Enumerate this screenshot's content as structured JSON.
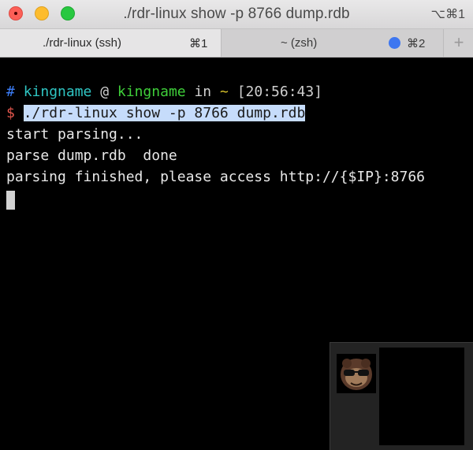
{
  "window": {
    "title": "./rdr-linux show -p 8766 dump.rdb",
    "shortcut": "⌥⌘1"
  },
  "tabs": [
    {
      "label": "./rdr-linux (ssh)",
      "shortcut": "⌘1",
      "active": true
    },
    {
      "label": "~ (zsh)",
      "shortcut": "⌘2",
      "active": false,
      "activity_color": "#3e77f0"
    }
  ],
  "new_tab_label": "+",
  "terminal": {
    "prompt": {
      "hash": "#",
      "user": "kingname",
      "at": "@",
      "host": "kingname",
      "in": "in",
      "dir": "~",
      "time": "[20:56:43]",
      "dollar": "$",
      "command": "./rdr-linux show -p 8766 dump.rdb"
    },
    "output": [
      "start parsing...",
      "parse dump.rdb  done",
      "parsing finished, please access http://{$IP}:8766"
    ]
  },
  "colors": {
    "prompt_hash": "#3b7cf5",
    "prompt_user": "#2fc5c3",
    "prompt_host": "#3fcf3a",
    "prompt_dir": "#d6c12a",
    "prompt_dollar": "#e2564d",
    "command_highlight": "#c6dcfb"
  }
}
